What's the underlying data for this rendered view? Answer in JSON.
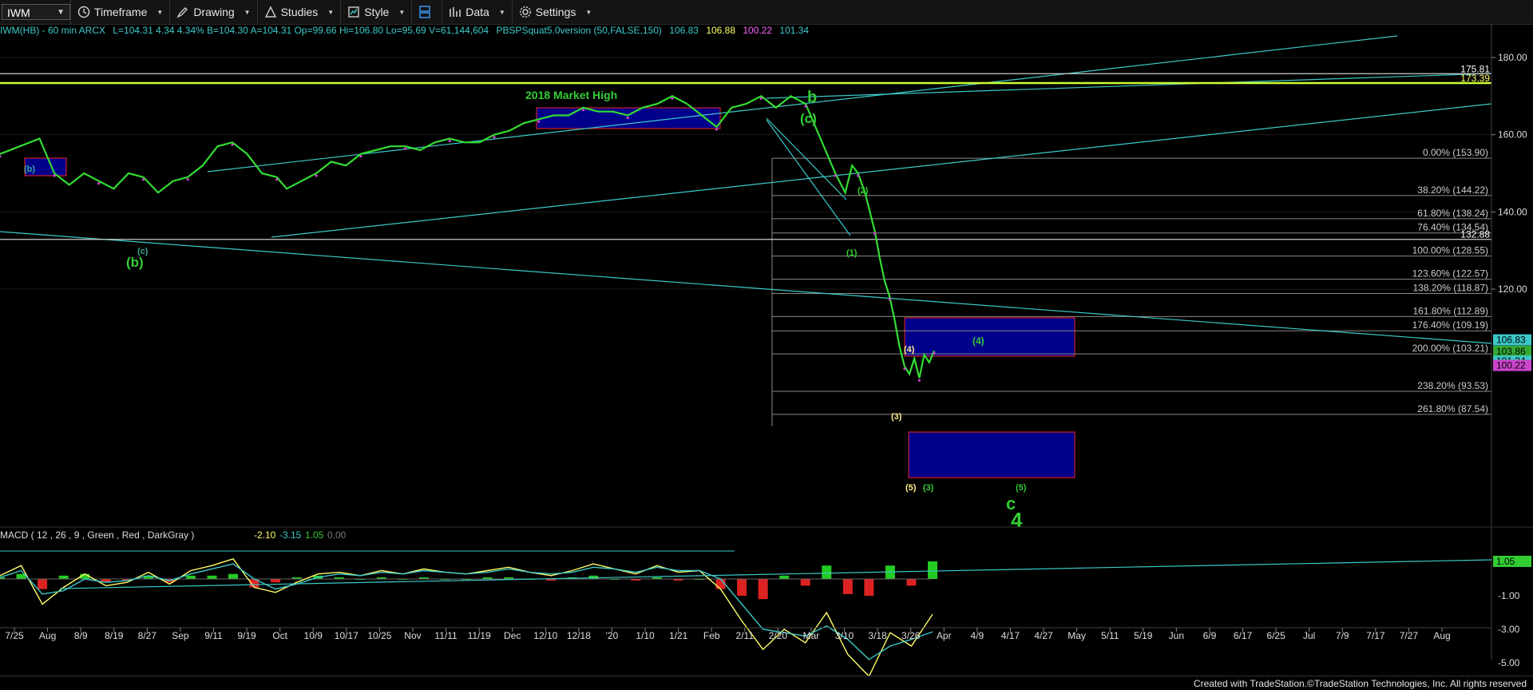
{
  "toolbar": {
    "symbol": "IWM",
    "items": [
      {
        "label": "Timeframe",
        "icon": "clock-icon"
      },
      {
        "label": "Drawing",
        "icon": "pencil-icon"
      },
      {
        "label": "Studies",
        "icon": "studies-icon"
      },
      {
        "label": "Style",
        "icon": "style-icon"
      },
      {
        "label": "",
        "icon": "layout-icon"
      },
      {
        "label": "Data",
        "icon": "data-icon"
      },
      {
        "label": "Settings",
        "icon": "gear-icon"
      }
    ]
  },
  "header": {
    "title": "IWM(HB) - 60 min  ARCX",
    "ohlc": "L=104.31  4.34  4.34%  B=104.30  A=104.31  Op=99.66  Hi=106.80  Lo=95.69  V=61,144,604",
    "study": "PBSPSquat5.0version (50,FALSE,150)",
    "values": [
      "106.83",
      "106.88",
      "100.22",
      "101.34"
    ],
    "value_colors": [
      "#3cc8c8",
      "#ffff66",
      "#ff66ff",
      "#3cc8c8"
    ]
  },
  "footer": "Created with TradeStation.©TradeStation Technologies, Inc. All rights reserved",
  "colors": {
    "price": "#33dd33",
    "fib": "#888888",
    "trend": "#3cc8c8",
    "level": "#ccff33",
    "box": "#00008b",
    "green_label": "#33cc33",
    "yellow_label": "#ffee88"
  },
  "chart_data": {
    "type": "line",
    "title": "",
    "price_axis": {
      "ticks": [
        180,
        160,
        140,
        120
      ],
      "range": [
        84,
        186
      ]
    },
    "time_axis": {
      "ticks": [
        "7/25",
        "Aug",
        "8/9",
        "8/19",
        "8/27",
        "Sep",
        "9/11",
        "9/19",
        "Oct",
        "10/9",
        "10/17",
        "10/25",
        "Nov",
        "11/11",
        "11/19",
        "Dec",
        "12/10",
        "12/18",
        "'20",
        "1/10",
        "1/21",
        "Feb",
        "2/11",
        "2/20",
        "Mar",
        "3/10",
        "3/18",
        "3/26",
        "Apr",
        "4/9",
        "4/17",
        "4/27",
        "May",
        "5/11",
        "5/19",
        "Jun",
        "6/9",
        "6/17",
        "6/25",
        "Jul",
        "7/9",
        "7/17",
        "7/27",
        "Aug"
      ]
    },
    "price_series": {
      "name": "IWM",
      "x": [
        0,
        20,
        40,
        55,
        70,
        85,
        100,
        115,
        130,
        145,
        160,
        175,
        190,
        205,
        220,
        235,
        250,
        265,
        280,
        290,
        305,
        320,
        335,
        350,
        365,
        380,
        395,
        410,
        425,
        440,
        455,
        470,
        485,
        500,
        515,
        530,
        545,
        560,
        575,
        590,
        605,
        620,
        635,
        650,
        665,
        680,
        695,
        710,
        725,
        740,
        755,
        770,
        785,
        800,
        815,
        825,
        835,
        845,
        855,
        862,
        868,
        875,
        880,
        885,
        890,
        895,
        900,
        905,
        910,
        915,
        920,
        925,
        930,
        935,
        940,
        945
      ],
      "y": [
        155,
        157,
        159,
        150,
        147,
        150,
        148,
        146,
        150,
        149,
        145,
        148,
        149,
        152,
        157,
        158,
        155,
        150,
        149,
        146,
        148,
        150,
        153,
        152,
        155,
        156,
        157,
        157,
        156,
        158,
        159,
        158,
        158,
        160,
        161,
        163,
        164,
        165,
        165,
        167,
        166,
        166,
        165,
        167,
        168,
        170,
        168,
        165,
        162,
        167,
        168,
        170,
        167,
        170,
        168,
        162,
        156,
        150,
        145,
        152,
        150,
        145,
        140,
        135,
        128,
        122,
        118,
        112,
        105,
        100,
        98,
        102,
        97,
        103,
        101,
        104
      ]
    },
    "horizontal_levels": [
      {
        "value": 175.81,
        "label": "175.81",
        "color": "#cccccc"
      },
      {
        "value": 173.39,
        "label": "173.39",
        "color": "#ccff33"
      },
      {
        "value": 132.88,
        "label": "132.88",
        "color": "#cccccc"
      }
    ],
    "fib_levels": [
      {
        "label": "0.00% (153.90)",
        "value": 153.9
      },
      {
        "label": "38.20% (144.22)",
        "value": 144.22
      },
      {
        "label": "61.80% (138.24)",
        "value": 138.24
      },
      {
        "label": "76.40% (134.54)",
        "value": 134.54
      },
      {
        "label": "100.00% (128.55)",
        "value": 128.55
      },
      {
        "label": "123.60% (122.57)",
        "value": 122.57
      },
      {
        "label": "138.20% (118.87)",
        "value": 118.87
      },
      {
        "label": "161.80% (112.89)",
        "value": 112.89
      },
      {
        "label": "176.40% (109.19)",
        "value": 109.19
      },
      {
        "label": "200.00% (103.21)",
        "value": 103.21
      },
      {
        "label": "238.20% (93.53)",
        "value": 93.53
      },
      {
        "label": "261.80% (87.54)",
        "value": 87.54
      }
    ],
    "axis_tags": [
      {
        "value": 106.83,
        "label": "106.83",
        "bg": "#3cc8c8"
      },
      {
        "value": 103.86,
        "label": "103.86",
        "bg": "#33aa33"
      },
      {
        "value": 101.34,
        "label": "101.34",
        "bg": "#3cc8c8"
      },
      {
        "value": 100.22,
        "label": "100.22",
        "bg": "#cc44cc"
      }
    ],
    "annotations": [
      {
        "text": "2018 Market High",
        "color": "#33cc33",
        "size": 14
      },
      {
        "text": "b",
        "color": "#33cc33",
        "size": 20
      },
      {
        "text": "(c)",
        "color": "#33cc33",
        "size": 17
      },
      {
        "text": "(b)",
        "color": "#33aa99",
        "size": 11
      },
      {
        "text": "(c)",
        "color": "#33aa99",
        "size": 11
      },
      {
        "text": "(b)",
        "color": "#33cc33",
        "size": 17
      },
      {
        "text": "(2)",
        "color": "#33cc33",
        "size": 11
      },
      {
        "text": "(1)",
        "color": "#33cc33",
        "size": 11
      },
      {
        "text": "(4)",
        "color": "#ffee88",
        "size": 11
      },
      {
        "text": "(4)",
        "color": "#33cc33",
        "size": 12
      },
      {
        "text": "(3)",
        "color": "#ffee88",
        "size": 11
      },
      {
        "text": "(5)",
        "color": "#ffee88",
        "size": 11
      },
      {
        "text": "(3)",
        "color": "#33cc33",
        "size": 11
      },
      {
        "text": "(5)",
        "color": "#33cc33",
        "size": 11
      },
      {
        "text": "c",
        "color": "#33cc33",
        "size": 22
      },
      {
        "text": "4",
        "color": "#33cc33",
        "size": 26
      }
    ],
    "macd": {
      "title": "MACD ( 12 , 26 , 9 , Green , Red , DarkGray )",
      "values": [
        "-2.10",
        "-3.15",
        "1.05",
        "0.00"
      ],
      "value_colors": [
        "#ffff66",
        "#3cc8c8",
        "#33cc33",
        "#777777"
      ],
      "ticks": [
        -1,
        -3,
        -5
      ],
      "tick_labels": [
        "-1.00",
        "-3.00",
        "-5.00"
      ],
      "range": [
        -6.2,
        1.9
      ],
      "current_tag": "1.05",
      "macd_line": [
        0.2,
        0.8,
        -1.5,
        -0.5,
        0.3,
        -0.4,
        -0.2,
        0.4,
        -0.3,
        0.5,
        0.8,
        1.2,
        -0.5,
        -0.8,
        -0.2,
        0.3,
        0.4,
        0.2,
        0.5,
        0.3,
        0.6,
        0.4,
        0.3,
        0.5,
        0.7,
        0.4,
        0.2,
        0.5,
        0.9,
        0.6,
        0.3,
        0.8,
        0.4,
        0.5,
        -0.6,
        -2.5,
        -4.2,
        -3.0,
        -3.8,
        -2.0,
        -4.5,
        -5.8,
        -3.2,
        -4.0,
        -2.1
      ],
      "signal_line": [
        0.1,
        0.5,
        -0.9,
        -0.7,
        0.0,
        -0.2,
        -0.1,
        0.2,
        -0.1,
        0.3,
        0.6,
        0.9,
        0.0,
        -0.6,
        -0.3,
        0.1,
        0.3,
        0.2,
        0.4,
        0.3,
        0.5,
        0.4,
        0.3,
        0.4,
        0.6,
        0.4,
        0.3,
        0.4,
        0.7,
        0.6,
        0.4,
        0.7,
        0.5,
        0.5,
        0.0,
        -1.5,
        -3.0,
        -3.2,
        -3.4,
        -2.8,
        -3.6,
        -4.8,
        -4.0,
        -3.6,
        -3.15
      ],
      "histogram": [
        0.1,
        0.3,
        -0.6,
        0.2,
        0.3,
        -0.2,
        -0.1,
        0.2,
        -0.2,
        0.2,
        0.2,
        0.3,
        -0.5,
        -0.2,
        0.1,
        0.2,
        0.1,
        0.0,
        0.1,
        0.0,
        0.1,
        0.0,
        0.0,
        0.1,
        0.1,
        0.0,
        -0.1,
        0.1,
        0.2,
        0.0,
        -0.1,
        0.1,
        -0.1,
        0.0,
        -0.6,
        -1.0,
        -1.2,
        0.2,
        -0.4,
        0.8,
        -0.9,
        -1.0,
        0.8,
        -0.4,
        1.05
      ]
    }
  }
}
